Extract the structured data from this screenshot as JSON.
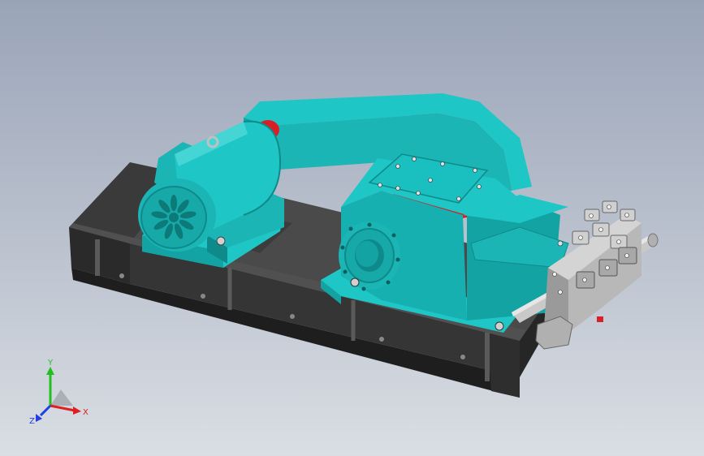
{
  "viewport": {
    "background_top": "#9aa4b8",
    "background_bottom": "#dadee4"
  },
  "model": {
    "colors": {
      "body": "#1fc6c6",
      "body_dark": "#14a3a3",
      "body_shade": "#0f8a8a",
      "flywheel": "#d91f26",
      "frame": "#2a2a2a",
      "frame_light": "#4a4a4a",
      "steel": "#c9c9c9",
      "steel_dark": "#8f8f8f"
    }
  },
  "triad": {
    "y_label": "Y",
    "x_label": "X",
    "z_label": "Z",
    "x_color": "#e02020",
    "y_color": "#20c020",
    "z_color": "#2040e0"
  }
}
